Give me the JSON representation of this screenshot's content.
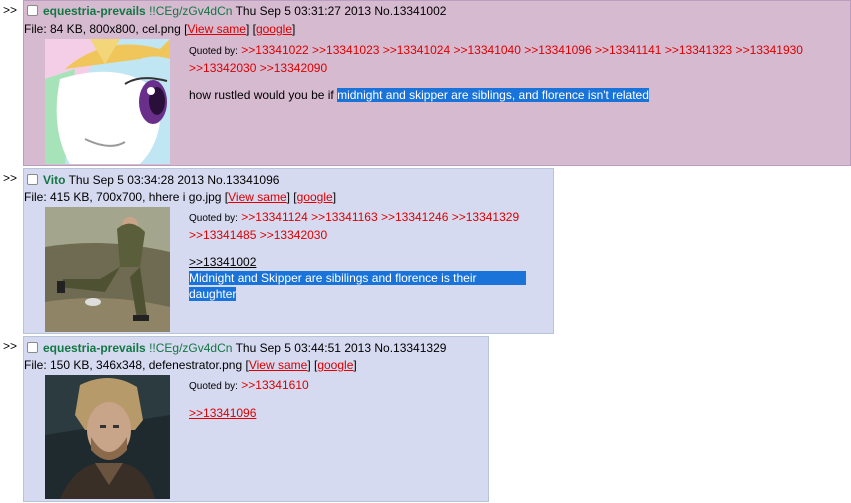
{
  "arrow": ">>",
  "posts": [
    {
      "name": "equestria-prevails",
      "trip": "!!CEg/zGv4dCn",
      "datetime": "Thu Sep 5 03:31:27 2013",
      "no": "No.13341002",
      "file_prefix": "File: 84 KB, 800x800, cel.png",
      "view_same": "View same",
      "google": "google",
      "quoted_by_label": "Quoted by:",
      "quoted_line1": ">>13341022 >>13341023 >>13341024 >>13341040 >>13341096 >>13341141 >>13341323 >>13341930",
      "quoted_line2": ">>13342030 >>13342090",
      "msg_plain": "how rustled would you be if ",
      "msg_selected": "midnight and skipper are siblings, and florence isn't related"
    },
    {
      "name": "Vito",
      "datetime": "Thu Sep 5 03:34:28 2013",
      "no": "No.13341096",
      "file_prefix": "File: 415 KB, 700x700, hhere i go.jpg",
      "view_same": "View same",
      "google": "google",
      "quoted_by_label": "Quoted by:",
      "quoted_line1": ">>13341124 >>13341163 >>13341246 >>13341329",
      "quoted_line2": ">>13341485 >>13342030",
      "reply_link": ">>13341002",
      "msg_line1": "Midnight and Skipper are sibilings and florence is their",
      "msg_line2": "daughter"
    },
    {
      "name": "equestria-prevails",
      "trip": "!!CEg/zGv4dCn",
      "datetime": "Thu Sep 5 03:44:51 2013",
      "no": "No.13341329",
      "file_prefix": "File: 150 KB, 346x348, defenestrator.png",
      "view_same": "View same",
      "google": "google",
      "quoted_by_label": "Quoted by:",
      "quoted_line1": ">>13341610",
      "reply_link": ">>13341096"
    }
  ]
}
